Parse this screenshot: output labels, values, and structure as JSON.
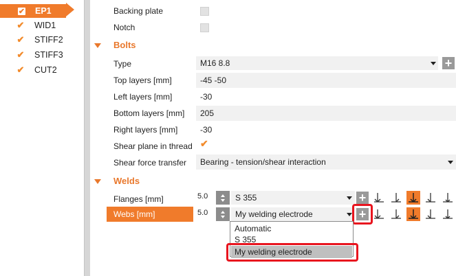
{
  "tree": {
    "items": [
      {
        "label": "EP1",
        "checked": true,
        "active": true
      },
      {
        "label": "WID1",
        "checked": true,
        "active": false
      },
      {
        "label": "STIFF2",
        "checked": true,
        "active": false
      },
      {
        "label": "STIFF3",
        "checked": true,
        "active": false
      },
      {
        "label": "CUT2",
        "checked": true,
        "active": false
      }
    ]
  },
  "plate": {
    "backing_plate_label": "Backing plate",
    "notch_label": "Notch"
  },
  "bolts": {
    "section_title": "Bolts",
    "type_label": "Type",
    "type_value": "M16 8.8",
    "top_layers_label": "Top layers [mm]",
    "top_layers_value": "-45 -50",
    "left_layers_label": "Left layers [mm]",
    "left_layers_value": "-30",
    "bottom_layers_label": "Bottom layers [mm]",
    "bottom_layers_value": "205",
    "right_layers_label": "Right layers [mm]",
    "right_layers_value": "-30",
    "shear_plane_label": "Shear plane in thread",
    "shear_plane_checked": true,
    "shear_force_label": "Shear force transfer",
    "shear_force_value": "Bearing - tension/shear interaction"
  },
  "welds": {
    "section_title": "Welds",
    "flanges_label": "Flanges [mm]",
    "flanges_size": "5.0",
    "flanges_material": "S 355",
    "webs_label": "Webs [mm]",
    "webs_size": "5.0",
    "webs_material": "My welding electrode",
    "selected_weld_type_index": 3,
    "dropdown_options": [
      "Automatic",
      "S 355",
      "My welding electrode"
    ],
    "dropdown_selected": "My welding electrode"
  },
  "colors": {
    "accent": "#f07b2b",
    "highlight": "#e8141e"
  }
}
